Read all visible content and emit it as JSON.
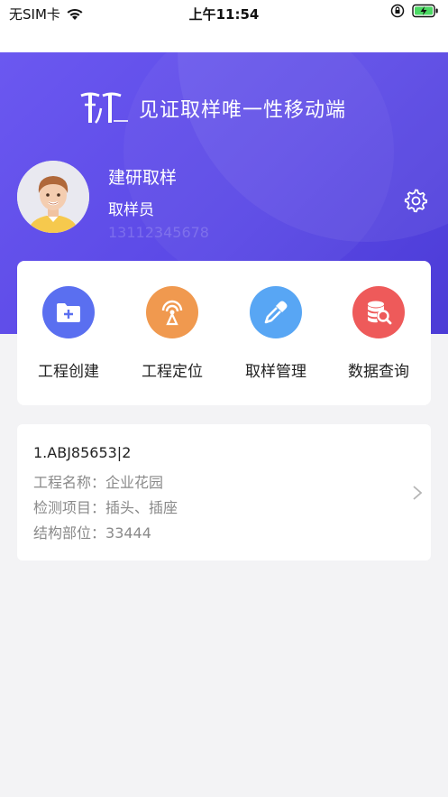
{
  "status_bar": {
    "carrier": "无SIM卡",
    "time": "上午11:54"
  },
  "header": {
    "app_title": "见证取样唯一性移动端"
  },
  "profile": {
    "name": "建研取样",
    "role": "取样员",
    "phone": "13112345678"
  },
  "actions": [
    {
      "label": "工程创建",
      "icon": "folder-plus-icon",
      "color": "#5a6ff0"
    },
    {
      "label": "工程定位",
      "icon": "location-signal-icon",
      "color": "#f0994f"
    },
    {
      "label": "取样管理",
      "icon": "dropper-icon",
      "color": "#58a6f4"
    },
    {
      "label": "数据查询",
      "icon": "database-search-icon",
      "color": "#ee5a5a"
    }
  ],
  "records": [
    {
      "id": "1.ABJ85653|2",
      "project_label": "工程名称：",
      "project": "企业花园",
      "test_label": "检测项目：",
      "test": "插头、插座",
      "part_label": "结构部位：",
      "part": "33444"
    }
  ]
}
